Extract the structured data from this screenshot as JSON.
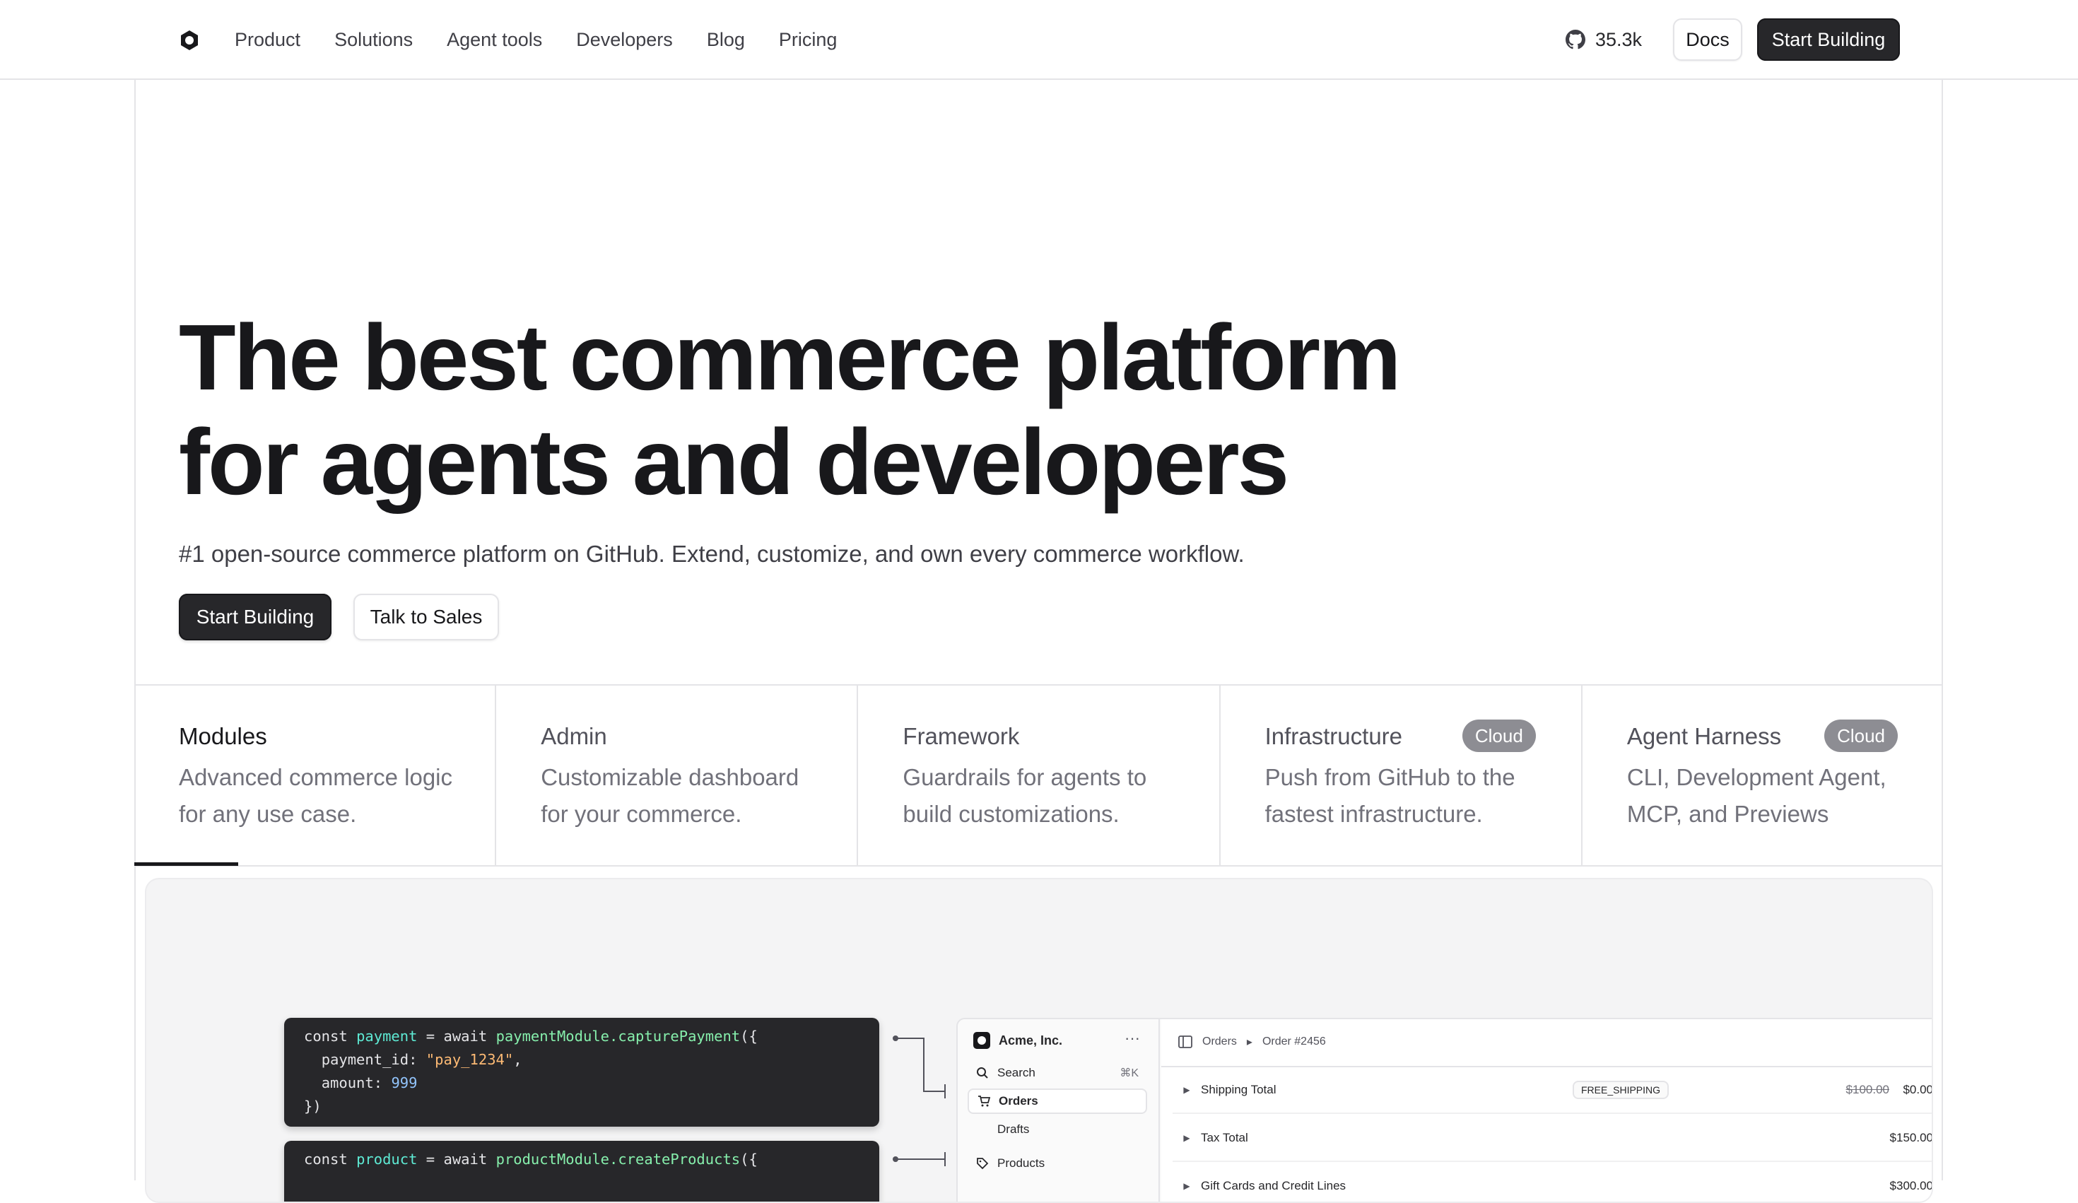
{
  "nav": {
    "links": [
      "Product",
      "Solutions",
      "Agent tools",
      "Developers",
      "Blog",
      "Pricing"
    ],
    "github_stars": "35.3k",
    "docs_label": "Docs",
    "start_label": "Start Building"
  },
  "hero": {
    "title_line1": "The best commerce platform",
    "title_line2": "for agents and developers",
    "subtitle": "#1 open-source commerce platform on GitHub. Extend, customize, and own every commerce workflow.",
    "primary_label": "Start Building",
    "secondary_label": "Talk to Sales"
  },
  "tabs": [
    {
      "title": "Modules",
      "desc": "Advanced commerce logic for any use case.",
      "badge": ""
    },
    {
      "title": "Admin",
      "desc": "Customizable dashboard for your commerce.",
      "badge": ""
    },
    {
      "title": "Framework",
      "desc": "Guardrails for agents to build customizations.",
      "badge": ""
    },
    {
      "title": "Infrastructure",
      "desc": "Push from GitHub to the fastest infrastructure.",
      "badge": "Cloud"
    },
    {
      "title": "Agent Harness",
      "desc": "CLI, Development Agent, MCP, and Previews",
      "badge": "Cloud"
    }
  ],
  "code": {
    "kw_const": "const",
    "kw_await": "await",
    "payment_var": "payment",
    "payment_call": "paymentModule.capturePayment",
    "payment_id_key": "payment_id",
    "payment_id_val": "\"pay_1234\"",
    "amount_key": "amount",
    "amount_val": "999",
    "product_var": "product",
    "product_call": "productModule.createProducts"
  },
  "admin": {
    "store_name": "Acme, Inc.",
    "more": "···",
    "search_label": "Search",
    "search_kbd": "⌘K",
    "orders_label": "Orders",
    "drafts_label": "Drafts",
    "products_label": "Products",
    "crumb_orders": "Orders",
    "crumb_order": "Order #2456",
    "rows": [
      {
        "label": "Shipping Total",
        "tag": "FREE_SHIPPING",
        "old": "$100.00",
        "price": "$0.00"
      },
      {
        "label": "Tax Total",
        "tag": "",
        "old": "",
        "price": "$150.00"
      },
      {
        "label": "Gift Cards and Credit Lines",
        "tag": "",
        "old": "",
        "price": "$300.00"
      }
    ]
  },
  "colors": {
    "primary": "#27272a",
    "border": "#e4e4e7",
    "badge": "#8d8d93"
  }
}
